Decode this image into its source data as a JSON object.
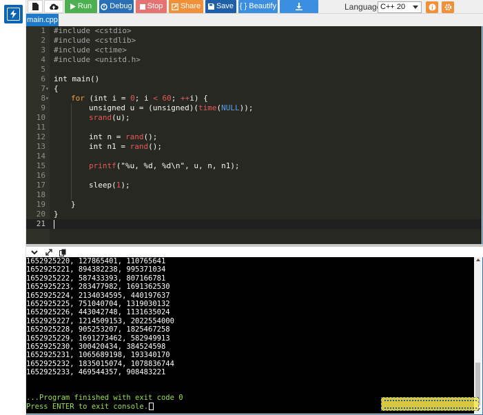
{
  "toolbar": {
    "run_label": "Run",
    "debug_label": "Debug",
    "stop_label": "Stop",
    "share_label": "Share",
    "save_label": "Save",
    "beautify_label": "{ } Beautify",
    "language_label": "Language",
    "language_value": "C++ 20"
  },
  "tabs": [
    {
      "label": "main.cpp"
    }
  ],
  "editor": {
    "line_numbers": [
      "1",
      "2",
      "3",
      "4",
      "5",
      "6",
      "7",
      "8",
      "9",
      "10",
      "11",
      "12",
      "13",
      "14",
      "15",
      "16",
      "17",
      "18",
      "19",
      "20",
      "21"
    ],
    "lines": {
      "l1_a": "#include ",
      "l1_b": "<cstdio>",
      "l2_a": "#include ",
      "l2_b": "<cstdlib>",
      "l3_a": "#include ",
      "l3_b": "<ctime>",
      "l4_a": "#include ",
      "l4_b": "<unistd.h>",
      "l6": "int main()",
      "l7": "{",
      "l8_kw": "for",
      "l8_a": " (int i = ",
      "l8_n0": "0",
      "l8_b": "; i ",
      "l8_lt": "<",
      "l8_c": " ",
      "l8_n60": "60",
      "l8_d": "; ",
      "l8_inc": "++",
      "l8_e": "i) {",
      "l9_a": "unsigned u = (unsigned)(",
      "l9_fn": "time",
      "l9_b": "(",
      "l9_null": "NULL",
      "l9_c": "));",
      "l10_fn": "srand",
      "l10_a": "(u);",
      "l12_a": "int n = ",
      "l12_fn": "rand",
      "l12_b": "();",
      "l13_a": "int n1 = ",
      "l13_fn": "rand",
      "l13_b": "();",
      "l15_fn": "printf",
      "l15_a": "(\"%u, %d, %d\\n\", u, n, n1);",
      "l17_a": "sleep(",
      "l17_n": "1",
      "l17_b": ");",
      "l19": "}",
      "l20": "}"
    }
  },
  "console": {
    "output_lines": [
      "1652925220, 127865401, 110765641",
      "1652925221, 894382238, 995371034",
      "1652925222, 587433393, 807166781",
      "1652925223, 283477982, 1691362530",
      "1652925224, 2134034595, 440197637",
      "1652925225, 751040704, 1319030132",
      "1652925226, 443042748, 1131635024",
      "1652925227, 1214509153, 2022554000",
      "1652925228, 905253207, 1825467258",
      "1652925229, 1691273462, 582949913",
      "1652925230, 300420434, 384524598",
      "1652925231, 1065689198, 193340170",
      "1652925232, 1835015074, 1078836744",
      "1652925233, 469544357, 908483221"
    ],
    "exit_message": "...Program finished with exit code 0",
    "enter_prompt": "Press ENTER to exit console."
  },
  "icons": {
    "logo": "lightning-logo-icon",
    "new_file": "file-icon",
    "upload": "upload-icon",
    "run": "play-icon",
    "debug": "bug-icon",
    "stop": "stop-icon",
    "share": "share-icon",
    "save": "floppy-icon",
    "download": "download-icon",
    "info": "info-icon",
    "settings": "gear-icon",
    "collapse": "chevron-down-icon",
    "expand": "expand-icon",
    "copy": "copy-icon"
  },
  "colors": {
    "run": "#4caf50",
    "debug": "#2a6fb6",
    "stop": "#e57373",
    "share": "#f0913a",
    "save": "#1e5fa8",
    "beautify": "#3c8ee0",
    "editor_bg": "#272822",
    "console_bg": "#000000",
    "console_green": "#9be04b"
  }
}
